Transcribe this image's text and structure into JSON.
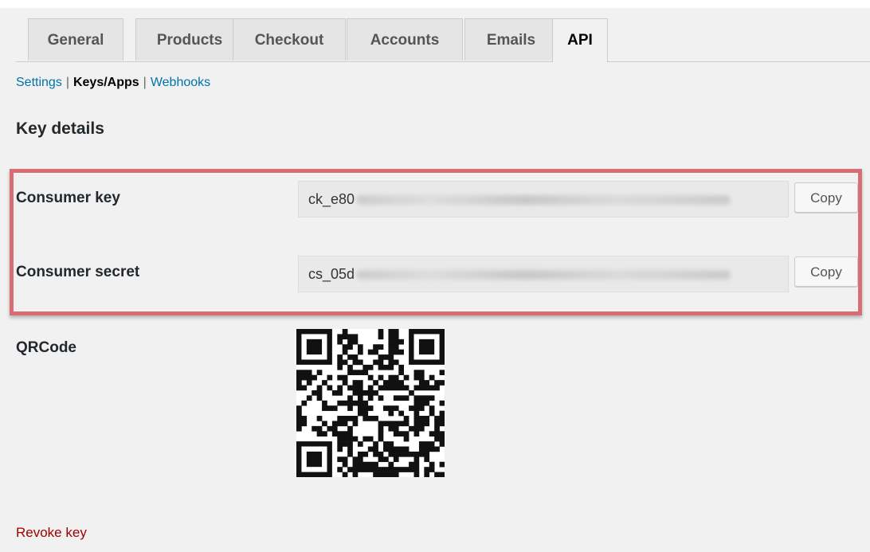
{
  "tabs": [
    {
      "label": "General"
    },
    {
      "label": "Products"
    },
    {
      "label": "Checkout"
    },
    {
      "label": "Accounts"
    },
    {
      "label": "Emails"
    },
    {
      "label": "API"
    }
  ],
  "active_tab": "API",
  "subnav": {
    "settings": "Settings",
    "keys_apps": "Keys/Apps",
    "webhooks": "Webhooks",
    "separator": "|"
  },
  "page": {
    "heading": "Key details"
  },
  "keys": {
    "consumer_key": {
      "label": "Consumer key",
      "value_prefix": "ck_e80",
      "copy_label": "Copy"
    },
    "consumer_secret": {
      "label": "Consumer secret",
      "value_prefix": "cs_05d",
      "copy_label": "Copy"
    }
  },
  "qr": {
    "label": "QRCode",
    "icon": "qr-code-image"
  },
  "revoke": {
    "label": "Revoke key"
  },
  "colors": {
    "highlight_border": "#d56e76",
    "link": "#0073aa",
    "revoke": "#a00000",
    "background": "#f1f1f1"
  }
}
